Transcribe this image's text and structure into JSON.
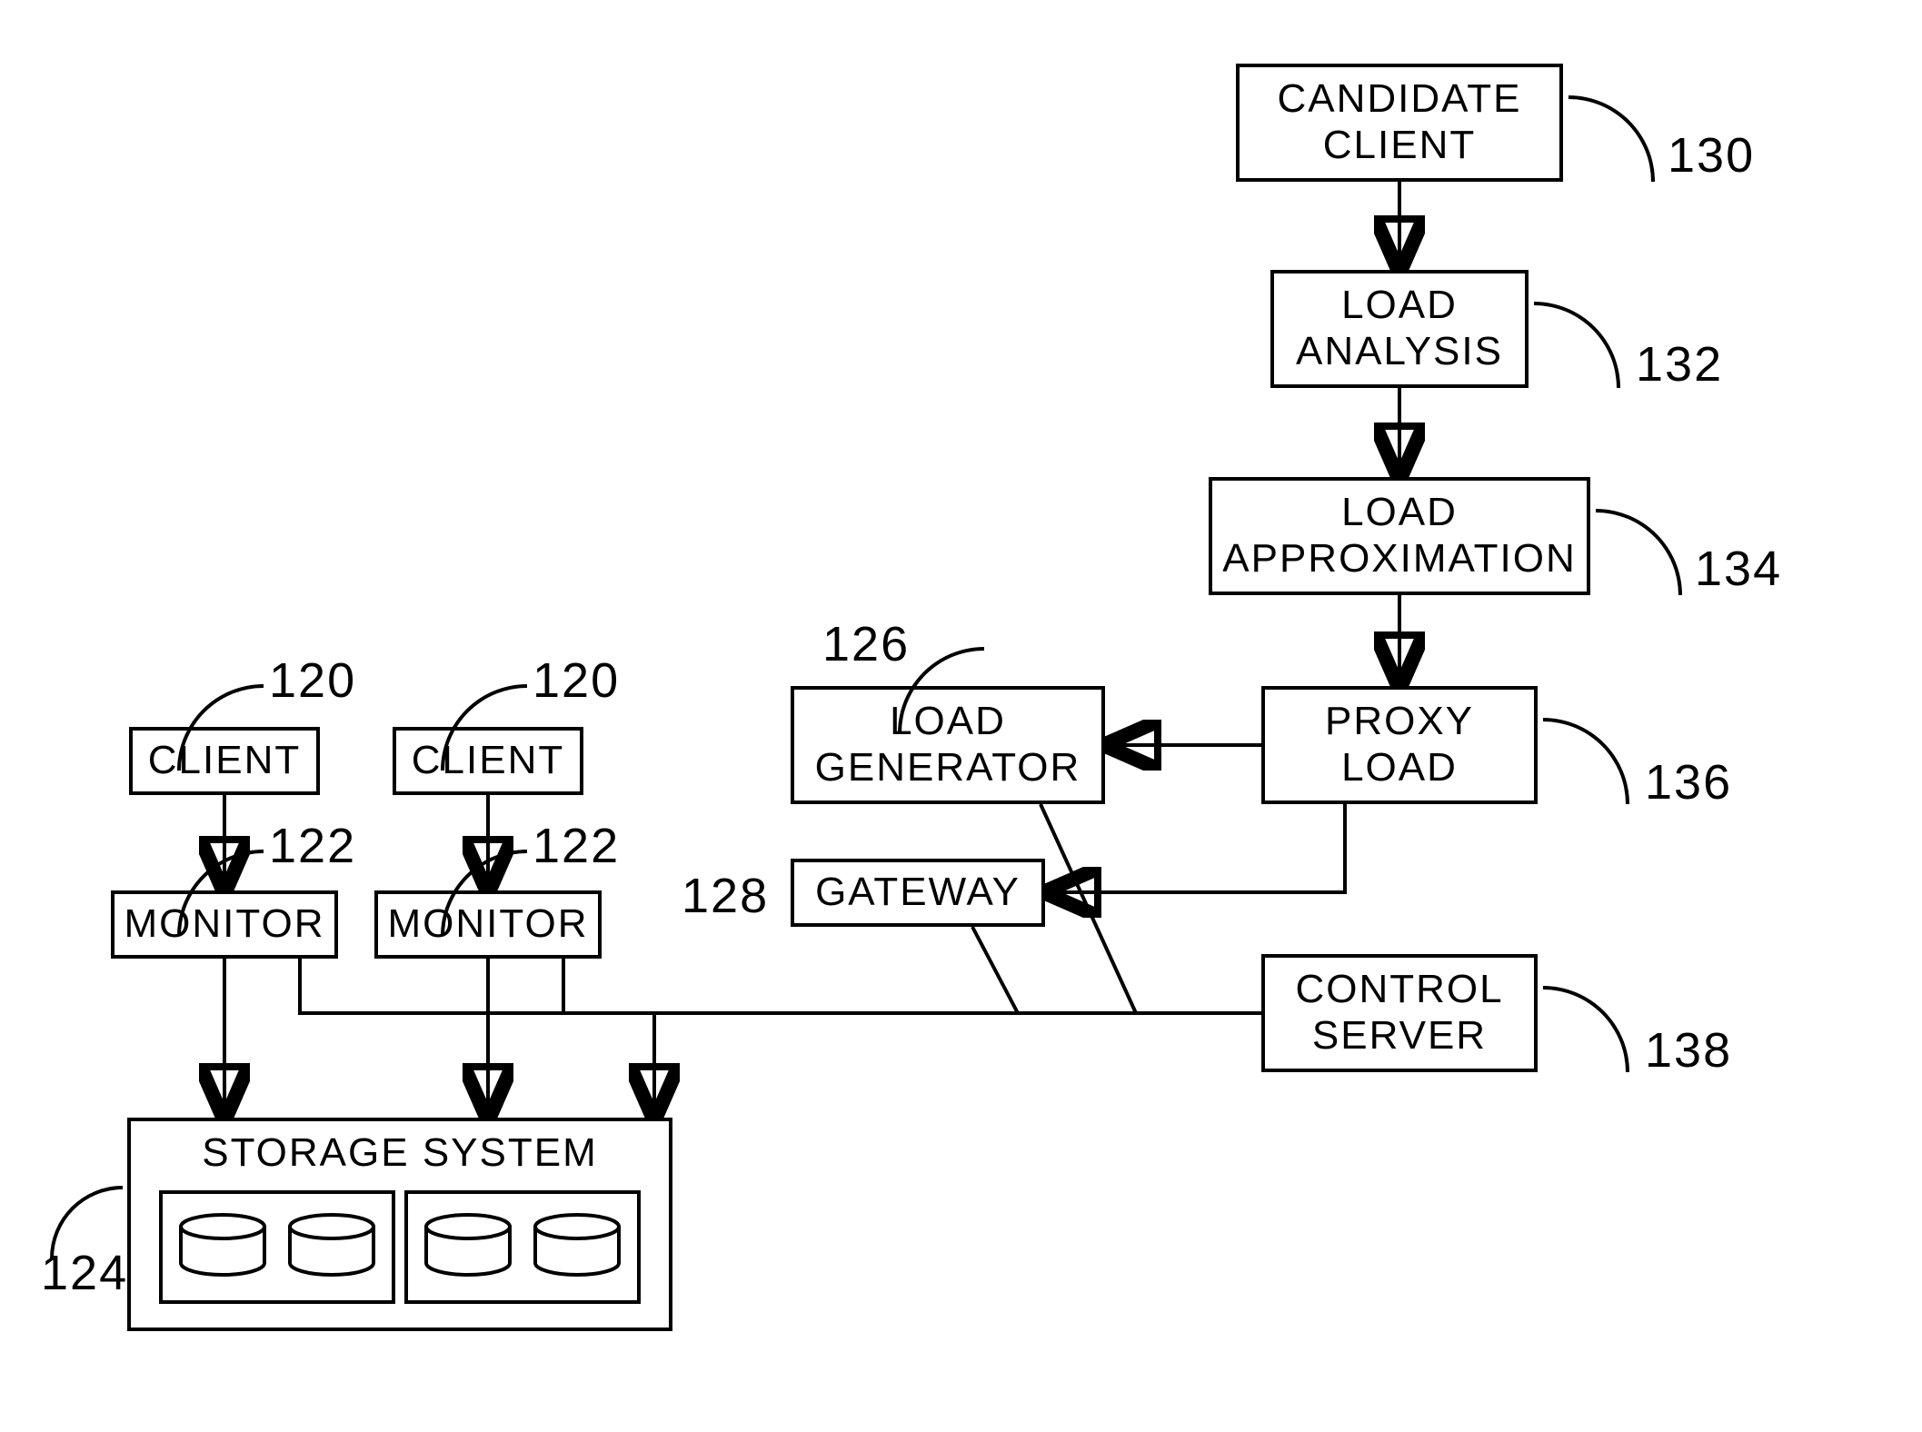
{
  "boxes": {
    "candidate_client": "CANDIDATE\nCLIENT",
    "load_analysis": "LOAD\nANALYSIS",
    "load_approximation": "LOAD\nAPPROXIMATION",
    "proxy_load": "PROXY\nLOAD",
    "load_generator": "LOAD\nGENERATOR",
    "gateway": "GATEWAY",
    "control_server": "CONTROL\nSERVER",
    "client": "CLIENT",
    "monitor": "MONITOR",
    "storage_system": "STORAGE SYSTEM"
  },
  "refs": {
    "client": "120",
    "monitor": "122",
    "storage": "124",
    "load_generator": "126",
    "gateway": "128",
    "candidate_client": "130",
    "load_analysis": "132",
    "load_approximation": "134",
    "proxy_load": "136",
    "control_server": "138"
  }
}
